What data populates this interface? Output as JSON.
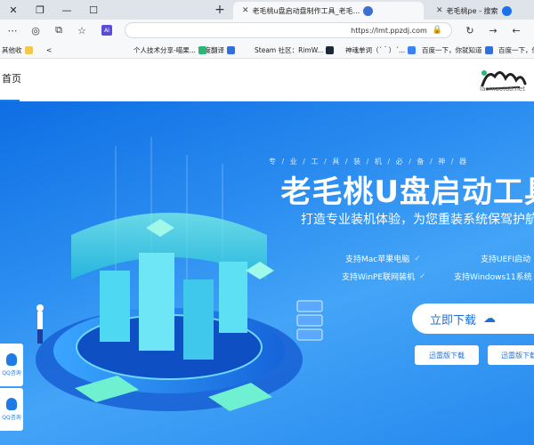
{
  "browser": {
    "tabs": [
      {
        "title": "老毛桃pe - 搜索"
      },
      {
        "title": "老毛桃u盘启动盘制作工具_老毛..."
      }
    ],
    "url": "https://lmt.ppzdj.com",
    "ai_badge": "AI",
    "bookmarks": [
      "其他收",
      "百度翻译",
      "个人技术分享-喵果...",
      "Steam 社区：RimW...",
      "神魂单词（ˊ＾）ˊ...",
      "百度一下，你就知道",
      "百度一下，你就知道"
    ]
  },
  "site": {
    "nav_home": "首页",
    "logo_domain": "laomaotao.net"
  },
  "hero": {
    "slogan_small": "专 / 业 / 工 / 具 / 装 / 机 / 必 / 备 / 神 / 器",
    "title": "老毛桃U盘启动工具",
    "subtitle": "打造专业装机体验，为您重装系统保驾护航",
    "features": [
      "支持UEFI启动",
      "支持Mac苹果电脑",
      "支持Windows11系统",
      "支持WinPE联网装机"
    ],
    "download_button": "立即下载",
    "download_icon": "cloud-download-icon",
    "mini_buttons": [
      "迅雷版下载",
      "迅雷版下载"
    ],
    "side_float": [
      "QQ咨询",
      "QQ咨询"
    ]
  },
  "colors": {
    "hero_blue": "#2a8cf0",
    "accent": "#1f7be6"
  }
}
